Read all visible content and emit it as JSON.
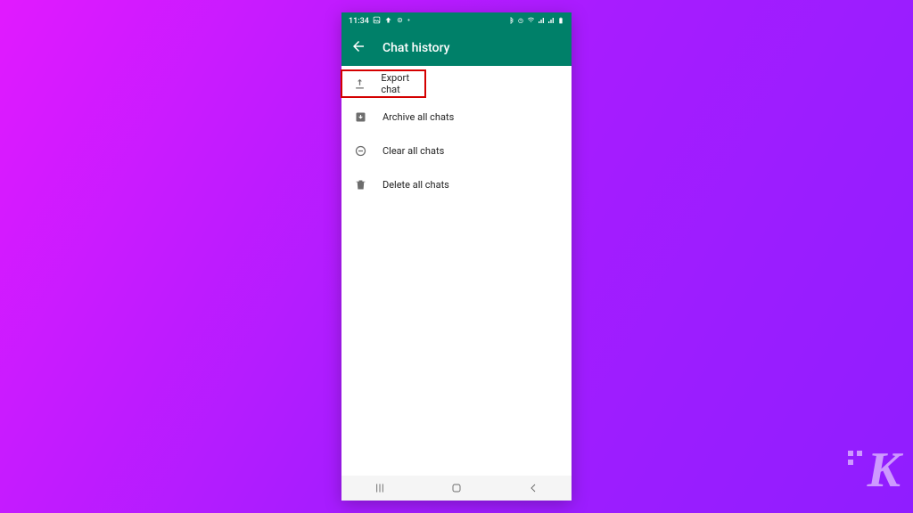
{
  "status": {
    "time": "11:34",
    "left_icons": [
      "image-icon",
      "cast-icon",
      "settings-icon"
    ],
    "right_icons": [
      "bluetooth-icon",
      "alarm-icon",
      "wifi-icon",
      "signal-icon",
      "signal-icon",
      "battery-icon"
    ]
  },
  "header": {
    "title": "Chat history"
  },
  "items": [
    {
      "icon": "upload-icon",
      "label": "Export chat",
      "highlight": true
    },
    {
      "icon": "archive-icon",
      "label": "Archive all chats",
      "highlight": false
    },
    {
      "icon": "clear-icon",
      "label": "Clear all chats",
      "highlight": false
    },
    {
      "icon": "trash-icon",
      "label": "Delete all chats",
      "highlight": false
    }
  ],
  "navbar": [
    "recent",
    "home",
    "back"
  ],
  "watermark": "K",
  "colors": {
    "accent": "#008069",
    "highlight": "#d40000"
  }
}
